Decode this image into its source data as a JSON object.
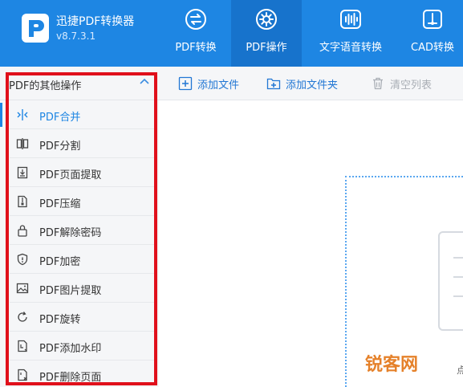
{
  "app": {
    "name": "迅捷PDF转换器",
    "version": "v8.7.3.1"
  },
  "tabs": [
    {
      "label": "PDF转换",
      "icon": "convert-icon"
    },
    {
      "label": "PDF操作",
      "icon": "gear-icon",
      "active": true
    },
    {
      "label": "文字语音转换",
      "icon": "waveform-icon"
    },
    {
      "label": "CAD转换",
      "icon": "cad-icon"
    }
  ],
  "sidebar": {
    "title": "PDF的其他操作",
    "items": [
      {
        "label": "PDF合并",
        "icon": "merge-icon",
        "active": true
      },
      {
        "label": "PDF分割",
        "icon": "split-icon"
      },
      {
        "label": "PDF页面提取",
        "icon": "page-extract-icon"
      },
      {
        "label": "PDF压缩",
        "icon": "compress-icon"
      },
      {
        "label": "PDF解除密码",
        "icon": "unlock-icon"
      },
      {
        "label": "PDF加密",
        "icon": "shield-icon"
      },
      {
        "label": "PDF图片提取",
        "icon": "image-icon"
      },
      {
        "label": "PDF旋转",
        "icon": "rotate-icon"
      },
      {
        "label": "PDF添加水印",
        "icon": "watermark-icon"
      },
      {
        "label": "PDF删除页面",
        "icon": "delete-page-icon"
      }
    ]
  },
  "toolbar": {
    "add_file": "添加文件",
    "add_folder": "添加文件夹",
    "clear_list": "清空列表"
  },
  "watermark_text": "锐客网",
  "edge_text": "点",
  "colors": {
    "brand": "#1e86e3",
    "active_tab": "#1773cc",
    "highlight_frame": "#e0101b"
  }
}
